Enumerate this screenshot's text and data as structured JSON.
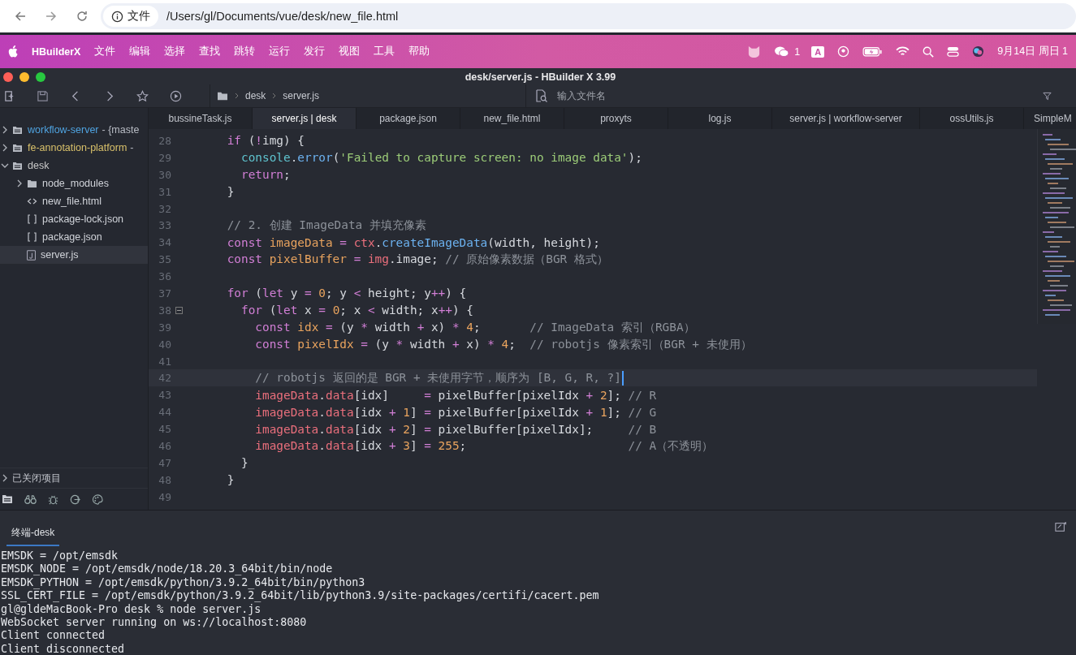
{
  "browser": {
    "badge": "文件",
    "url": "/Users/gl/Documents/vue/desk/new_file.html"
  },
  "menu_bar": {
    "app": "HBuilderX",
    "items": [
      "文件",
      "编辑",
      "选择",
      "查找",
      "跳转",
      "运行",
      "发行",
      "视图",
      "工具",
      "帮助"
    ],
    "chat_count": "1",
    "input_method": "A",
    "clock": "9月14日 周日 1"
  },
  "window": {
    "title": "desk/server.js - HBuilder X 3.99"
  },
  "toolbar": {
    "breadcrumb": [
      "desk",
      "server.js"
    ],
    "search": {
      "placeholder": "输入文件名"
    }
  },
  "sidebar": {
    "items": [
      {
        "label": "workflow-server",
        "suffix": "- {maste",
        "kind": "project",
        "color": "#4fa3e0",
        "expanded": false,
        "selected": false
      },
      {
        "label": "fe-annotation-platform",
        "suffix": "-",
        "kind": "project",
        "color": "#d8c06a",
        "expanded": false,
        "selected": false
      },
      {
        "label": "desk",
        "kind": "project",
        "color": "#c8c8c8",
        "expanded": true,
        "selected": false,
        "children": [
          {
            "label": "node_modules",
            "kind": "folder",
            "expanded": false,
            "selected": false
          },
          {
            "label": "new_file.html",
            "kind": "html",
            "selected": false
          },
          {
            "label": "package-lock.json",
            "kind": "json",
            "selected": false
          },
          {
            "label": "package.json",
            "kind": "json",
            "selected": false
          },
          {
            "label": "server.js",
            "kind": "js",
            "selected": true
          }
        ]
      }
    ],
    "closed_projects": {
      "label": "已关闭项目",
      "expanded": false
    }
  },
  "tabs": [
    {
      "label": "bussineTask.js",
      "selected": false
    },
    {
      "label": "server.js | desk",
      "selected": true
    },
    {
      "label": "package.json",
      "selected": false
    },
    {
      "label": "new_file.html",
      "selected": false
    },
    {
      "label": "proxyts",
      "selected": false
    },
    {
      "label": "log.js",
      "selected": false
    },
    {
      "label": "server.js | workflow-server",
      "selected": false
    },
    {
      "label": "ossUtils.js",
      "selected": false
    },
    {
      "label": "SimpleM",
      "selected": false
    }
  ],
  "editor": {
    "lines": [
      {
        "number": "28",
        "tokens": [
          {
            "text": "    if",
            "kind": "kw"
          },
          {
            "text": " (",
            "kind": "plain"
          },
          {
            "text": "!",
            "kind": "op"
          },
          {
            "text": "img) {",
            "kind": "plain"
          }
        ]
      },
      {
        "number": "29",
        "tokens": [
          {
            "text": "      console",
            "kind": "obj"
          },
          {
            "text": ".",
            "kind": "plain"
          },
          {
            "text": "error",
            "kind": "fn"
          },
          {
            "text": "(",
            "kind": "plain"
          },
          {
            "text": "'Failed to capture screen: no image data'",
            "kind": "str"
          },
          {
            "text": ");",
            "kind": "plain"
          }
        ]
      },
      {
        "number": "30",
        "tokens": [
          {
            "text": "      return",
            "kind": "kw"
          },
          {
            "text": ";",
            "kind": "plain"
          }
        ]
      },
      {
        "number": "31",
        "tokens": [
          {
            "text": "    }",
            "kind": "plain"
          }
        ]
      },
      {
        "number": "32"
      },
      {
        "number": "33",
        "tokens": [
          {
            "text": "    // 2. 创建 ImageData 并填充像素",
            "kind": "cm"
          }
        ]
      },
      {
        "number": "34",
        "tokens": [
          {
            "text": "    const",
            "kind": "kw"
          },
          {
            "text": " imageData ",
            "kind": "var"
          },
          {
            "text": "=",
            "kind": "op"
          },
          {
            "text": " ctx",
            "kind": "prop"
          },
          {
            "text": ".",
            "kind": "plain"
          },
          {
            "text": "createImageData",
            "kind": "fn"
          },
          {
            "text": "(width, height);",
            "kind": "plain"
          }
        ]
      },
      {
        "number": "35",
        "tokens": [
          {
            "text": "    const",
            "kind": "kw"
          },
          {
            "text": " pixelBuffer ",
            "kind": "var"
          },
          {
            "text": "=",
            "kind": "op"
          },
          {
            "text": " img",
            "kind": "prop"
          },
          {
            "text": ".image; ",
            "kind": "plain"
          },
          {
            "text": "// 原始像素数据（BGR 格式）",
            "kind": "cm"
          }
        ]
      },
      {
        "number": "36"
      },
      {
        "number": "37",
        "tokens": [
          {
            "text": "    for",
            "kind": "kw"
          },
          {
            "text": " (",
            "kind": "plain"
          },
          {
            "text": "let",
            "kind": "kw"
          },
          {
            "text": " y ",
            "kind": "plain"
          },
          {
            "text": "=",
            "kind": "op"
          },
          {
            "text": " 0",
            "kind": "num"
          },
          {
            "text": "; y ",
            "kind": "plain"
          },
          {
            "text": "<",
            "kind": "op"
          },
          {
            "text": " height; y",
            "kind": "plain"
          },
          {
            "text": "++",
            "kind": "op"
          },
          {
            "text": ") {",
            "kind": "plain"
          }
        ]
      },
      {
        "number": "38",
        "fold": true,
        "tokens": [
          {
            "text": "      for",
            "kind": "kw"
          },
          {
            "text": " (",
            "kind": "plain"
          },
          {
            "text": "let",
            "kind": "kw"
          },
          {
            "text": " x ",
            "kind": "plain"
          },
          {
            "text": "=",
            "kind": "op"
          },
          {
            "text": " 0",
            "kind": "num"
          },
          {
            "text": "; x ",
            "kind": "plain"
          },
          {
            "text": "<",
            "kind": "op"
          },
          {
            "text": " width; x",
            "kind": "plain"
          },
          {
            "text": "++",
            "kind": "op"
          },
          {
            "text": ") {",
            "kind": "plain"
          }
        ]
      },
      {
        "number": "39",
        "tokens": [
          {
            "text": "        const",
            "kind": "kw"
          },
          {
            "text": " idx ",
            "kind": "var"
          },
          {
            "text": "=",
            "kind": "op"
          },
          {
            "text": " (y ",
            "kind": "plain"
          },
          {
            "text": "*",
            "kind": "op"
          },
          {
            "text": " width ",
            "kind": "plain"
          },
          {
            "text": "+",
            "kind": "op"
          },
          {
            "text": " x) ",
            "kind": "plain"
          },
          {
            "text": "*",
            "kind": "op"
          },
          {
            "text": " 4",
            "kind": "num"
          },
          {
            "text": ";       ",
            "kind": "plain"
          },
          {
            "text": "// ImageData 索引（RGBA）",
            "kind": "cm"
          }
        ]
      },
      {
        "number": "40",
        "tokens": [
          {
            "text": "        const",
            "kind": "kw"
          },
          {
            "text": " pixelIdx ",
            "kind": "var"
          },
          {
            "text": "=",
            "kind": "op"
          },
          {
            "text": " (y ",
            "kind": "plain"
          },
          {
            "text": "*",
            "kind": "op"
          },
          {
            "text": " width ",
            "kind": "plain"
          },
          {
            "text": "+",
            "kind": "op"
          },
          {
            "text": " x) ",
            "kind": "plain"
          },
          {
            "text": "*",
            "kind": "op"
          },
          {
            "text": " 4",
            "kind": "num"
          },
          {
            "text": ";  ",
            "kind": "plain"
          },
          {
            "text": "// robotjs 像素索引（BGR + 未使用）",
            "kind": "cm"
          }
        ]
      },
      {
        "number": "41"
      },
      {
        "number": "42",
        "current": true,
        "tokens": [
          {
            "text": "        // robotjs 返回的是 BGR + 未使用字节，顺序为 [B, G, R, ?]",
            "kind": "cm"
          }
        ]
      },
      {
        "number": "43",
        "tokens": [
          {
            "text": "        imageData",
            "kind": "prop"
          },
          {
            "text": ".",
            "kind": "plain"
          },
          {
            "text": "data",
            "kind": "prop"
          },
          {
            "text": "[idx]     ",
            "kind": "plain"
          },
          {
            "text": "=",
            "kind": "op"
          },
          {
            "text": " pixelBuffer[pixelIdx ",
            "kind": "plain"
          },
          {
            "text": "+",
            "kind": "op"
          },
          {
            "text": " 2",
            "kind": "num"
          },
          {
            "text": "]; ",
            "kind": "plain"
          },
          {
            "text": "// R",
            "kind": "cm"
          }
        ]
      },
      {
        "number": "44",
        "tokens": [
          {
            "text": "        imageData",
            "kind": "prop"
          },
          {
            "text": ".",
            "kind": "plain"
          },
          {
            "text": "data",
            "kind": "prop"
          },
          {
            "text": "[idx ",
            "kind": "plain"
          },
          {
            "text": "+",
            "kind": "op"
          },
          {
            "text": " 1",
            "kind": "num"
          },
          {
            "text": "] ",
            "kind": "plain"
          },
          {
            "text": "=",
            "kind": "op"
          },
          {
            "text": " pixelBuffer[pixelIdx ",
            "kind": "plain"
          },
          {
            "text": "+",
            "kind": "op"
          },
          {
            "text": " 1",
            "kind": "num"
          },
          {
            "text": "]; ",
            "kind": "plain"
          },
          {
            "text": "// G",
            "kind": "cm"
          }
        ]
      },
      {
        "number": "45",
        "tokens": [
          {
            "text": "        imageData",
            "kind": "prop"
          },
          {
            "text": ".",
            "kind": "plain"
          },
          {
            "text": "data",
            "kind": "prop"
          },
          {
            "text": "[idx ",
            "kind": "plain"
          },
          {
            "text": "+",
            "kind": "op"
          },
          {
            "text": " 2",
            "kind": "num"
          },
          {
            "text": "] ",
            "kind": "plain"
          },
          {
            "text": "=",
            "kind": "op"
          },
          {
            "text": " pixelBuffer[pixelIdx];     ",
            "kind": "plain"
          },
          {
            "text": "// B",
            "kind": "cm"
          }
        ]
      },
      {
        "number": "46",
        "tokens": [
          {
            "text": "        imageData",
            "kind": "prop"
          },
          {
            "text": ".",
            "kind": "plain"
          },
          {
            "text": "data",
            "kind": "prop"
          },
          {
            "text": "[idx ",
            "kind": "plain"
          },
          {
            "text": "+",
            "kind": "op"
          },
          {
            "text": " 3",
            "kind": "num"
          },
          {
            "text": "] ",
            "kind": "plain"
          },
          {
            "text": "=",
            "kind": "op"
          },
          {
            "text": " 255",
            "kind": "num"
          },
          {
            "text": ";                       ",
            "kind": "plain"
          },
          {
            "text": "// A（不透明）",
            "kind": "cm"
          }
        ]
      },
      {
        "number": "47",
        "tokens": [
          {
            "text": "      }",
            "kind": "plain"
          }
        ]
      },
      {
        "number": "48",
        "tokens": [
          {
            "text": "    }",
            "kind": "plain"
          }
        ]
      },
      {
        "number": "49"
      }
    ]
  },
  "terminal": {
    "tabs": [
      {
        "label": "终端-desk",
        "selected": true
      }
    ],
    "lines": [
      "EMSDK = /opt/emsdk",
      "EMSDK_NODE = /opt/emsdk/node/18.20.3_64bit/bin/node",
      "EMSDK_PYTHON = /opt/emsdk/python/3.9.2_64bit/bin/python3",
      "SSL_CERT_FILE = /opt/emsdk/python/3.9.2_64bit/lib/python3.9/site-packages/certifi/cacert.pem",
      "gl@gldeMacBook-Pro desk % node server.js",
      "WebSocket server running on ws://localhost:8080",
      "Client connected",
      "Client disconnected"
    ]
  }
}
